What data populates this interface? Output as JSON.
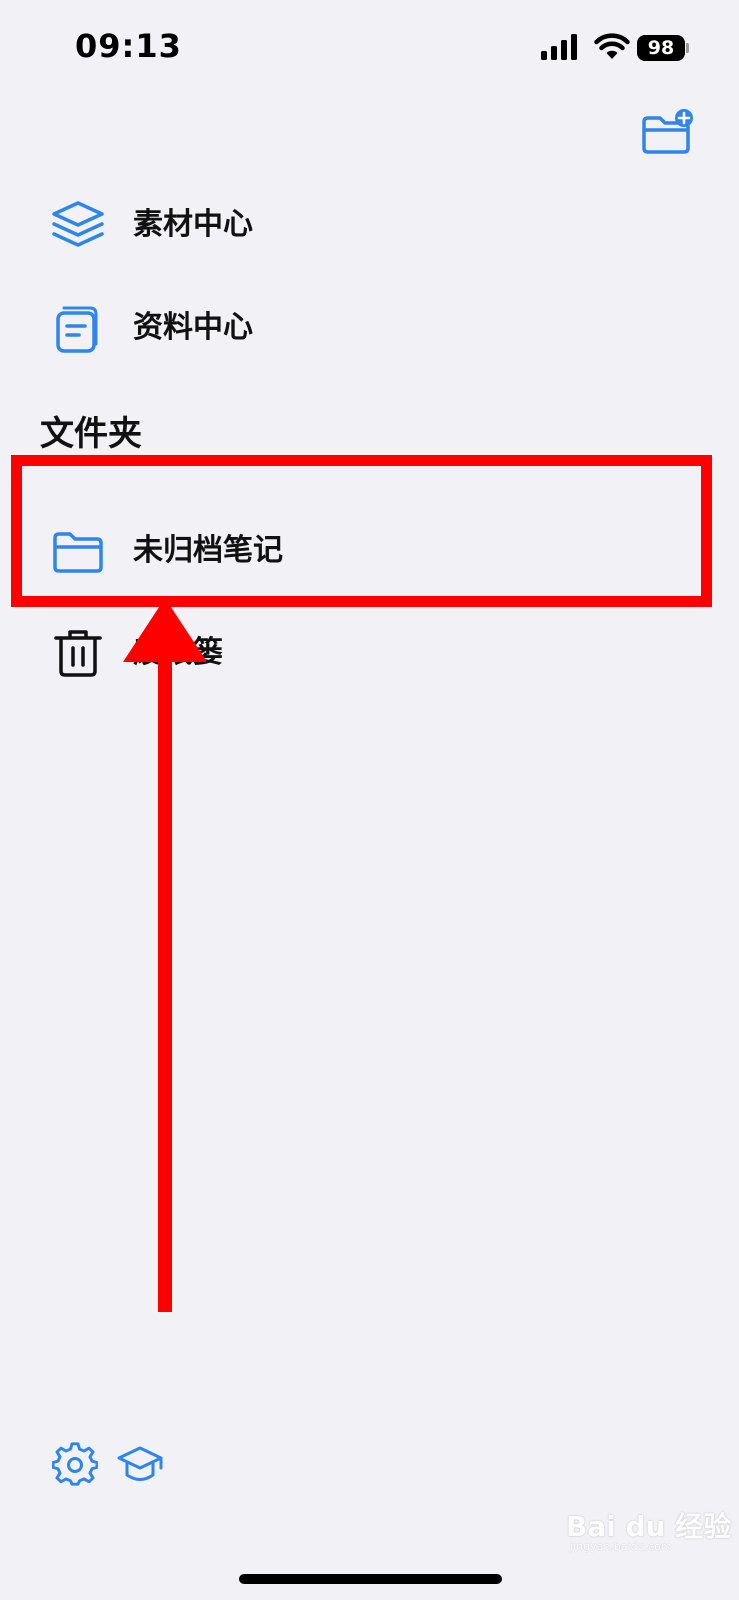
{
  "status_bar": {
    "time": "09:13",
    "battery_level": "98"
  },
  "menu": {
    "items": [
      {
        "label": "素材中心",
        "icon": "layers-icon"
      },
      {
        "label": "资料中心",
        "icon": "document-icon"
      }
    ]
  },
  "folders": {
    "section_title": "文件夹",
    "items": [
      {
        "label": "未归档笔记",
        "icon": "folder-icon"
      },
      {
        "label": "废纸篓",
        "icon": "trash-icon"
      }
    ]
  },
  "bottom_bar": {
    "icons": [
      "gear-icon",
      "graduation-cap-icon"
    ]
  },
  "watermark": {
    "brand": "Bai du 经验",
    "url": "jingyan.baidu.com"
  },
  "colors": {
    "accent": "#2f86ea",
    "annotation": "#ff0000",
    "background": "#f1f1f6"
  }
}
